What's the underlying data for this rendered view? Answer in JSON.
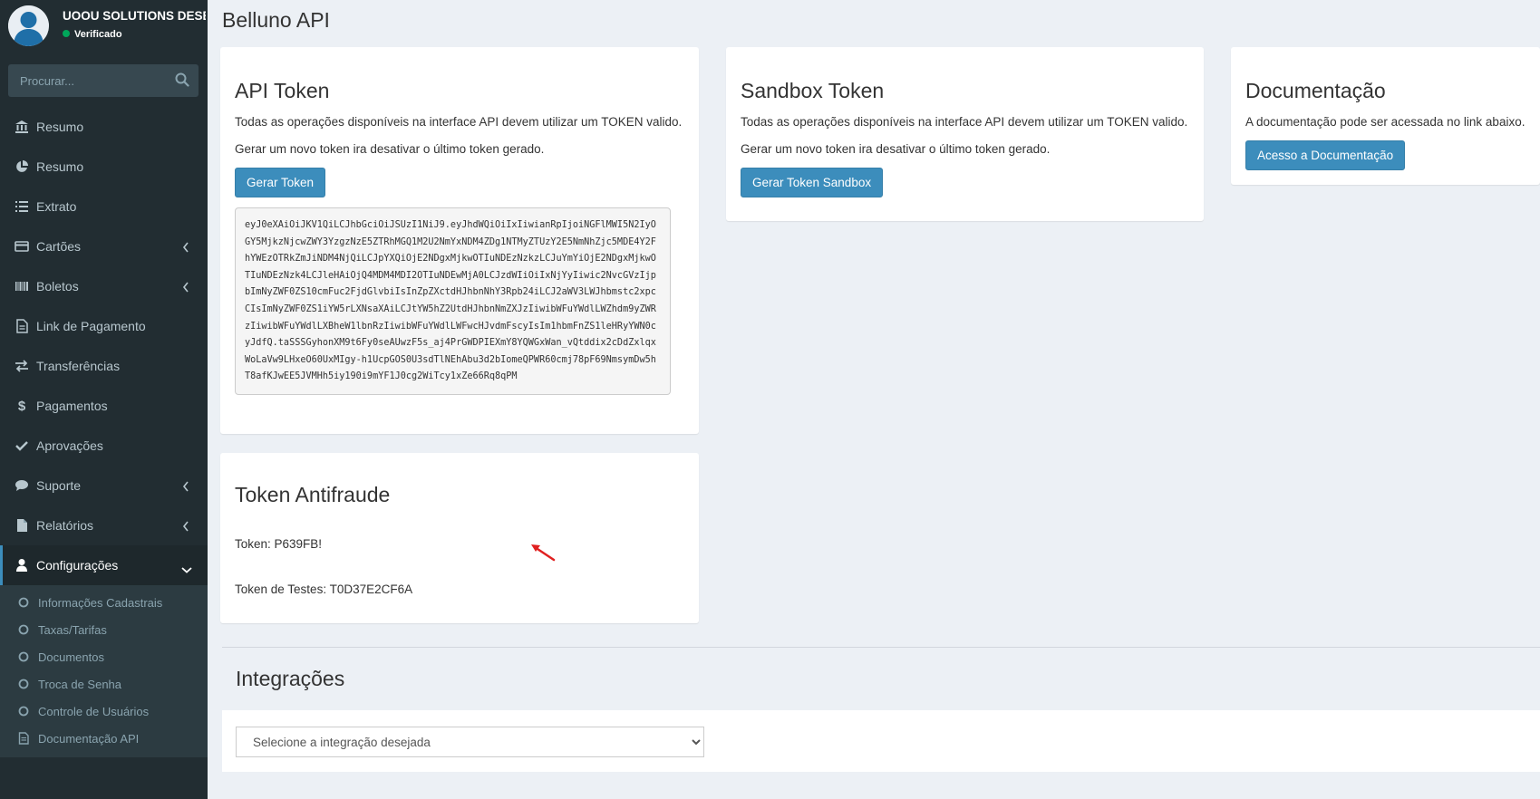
{
  "user": {
    "name": "UOOU SOLUTIONS DESE",
    "status": "Verificado"
  },
  "search": {
    "placeholder": "Procurar..."
  },
  "sidebar": {
    "items": [
      {
        "label": "Resumo",
        "icon": "bank-icon"
      },
      {
        "label": "Resumo",
        "icon": "pie-chart-icon"
      },
      {
        "label": "Extrato",
        "icon": "list-icon"
      },
      {
        "label": "Cartões",
        "icon": "credit-card-icon"
      },
      {
        "label": "Boletos",
        "icon": "barcode-icon"
      },
      {
        "label": "Link de Pagamento",
        "icon": "file-icon"
      },
      {
        "label": "Transferências",
        "icon": "exchange-icon"
      },
      {
        "label": "Pagamentos",
        "icon": "dollar-icon"
      },
      {
        "label": "Aprovações",
        "icon": "check-icon"
      },
      {
        "label": "Suporte",
        "icon": "comment-icon"
      },
      {
        "label": "Relatórios",
        "icon": "file-text-icon"
      },
      {
        "label": "Configurações",
        "icon": "user-icon"
      }
    ],
    "submenu": [
      {
        "label": "Informações Cadastrais"
      },
      {
        "label": "Taxas/Tarifas"
      },
      {
        "label": "Documentos"
      },
      {
        "label": "Troca de Senha"
      },
      {
        "label": "Controle de Usuários"
      },
      {
        "label": "Documentação API"
      }
    ]
  },
  "page": {
    "title": "Belluno API"
  },
  "api_token": {
    "title": "API Token",
    "desc1": "Todas as operações disponíveis na interface API devem utilizar um TOKEN valido.",
    "desc2": "Gerar um novo token ira desativar o último token gerado.",
    "button": "Gerar Token",
    "token": "eyJ0eXAiOiJKV1QiLCJhbGciOiJSUzI1NiJ9.eyJhdWQiOiIxIiwianRpIjoiNGFlMWI5N2IyOGY5MjkzNjcwZWY3YzgzNzE5ZTRhMGQ1M2U2NmYxNDM4ZDg1NTMyZTUzY2E5NmNhZjc5MDE4Y2FhYWEzOTRkZmJiNDM4NjQiLCJpYXQiOjE2NDgxMjkwOTIuNDEzNzkzLCJuYmYiOjE2NDgxMjkwOTIuNDEzNzk4LCJleHAiOjQ4MDM4MDI2OTIuNDEwMjA0LCJzdWIiOiIxNjYyIiwic2NvcGVzIjpbImNyZWF0ZS10cmFuc2FjdGlvbiIsInZpZXctdHJhbnNhY3Rpb24iLCJ2aWV3LWJhbmstc2xpcCIsImNyZWF0ZS1iYW5rLXNsaXAiLCJtYW5hZ2UtdHJhbnNmZXJzIiwibWFuYWdlLWZhdm9yZWRzIiwibWFuYWdlLXBheW1lbnRzIiwibWFuYWdlLWFwcHJvdmFscyIsIm1hbmFnZS1leHRyYWN0cyJdfQ.taSSSGyhonXM9t6Fy0seAUwzF5s_aj4PrGWDPIEXmY8YQWGxWan_vQtddix2cDdZxlqxWoLaVw9LHxeO60UxMIgy-h1UcpGOS0U3sdTlNEhAbu3d2bIomeQPWR60cmj78pF69NmsymDw5hT8afKJwEE5JVMHh5iy190i9mYF1J0cg2WiTcy1xZe66Rq8qPM"
  },
  "sandbox_token": {
    "title": "Sandbox Token",
    "desc1": "Todas as operações disponíveis na interface API devem utilizar um TOKEN valido.",
    "desc2": "Gerar um novo token ira desativar o último token gerado.",
    "button": "Gerar Token Sandbox"
  },
  "documentacao": {
    "title": "Documentação",
    "desc": "A documentação pode ser acessada no link abaixo.",
    "button": "Acesso a Documentação"
  },
  "antifraude": {
    "title": "Token Antifraude",
    "token_label": "Token: P639FB!",
    "test_token_label": "Token de Testes: T0D37E2CF6A"
  },
  "integracoes": {
    "title": "Integrações",
    "select_value": "Selecione a integração desejada"
  },
  "colors": {
    "sidebar_bg": "#222d32",
    "primary": "#3c8dbc",
    "content_bg": "#ecf0f5",
    "arrow": "#e02020"
  }
}
